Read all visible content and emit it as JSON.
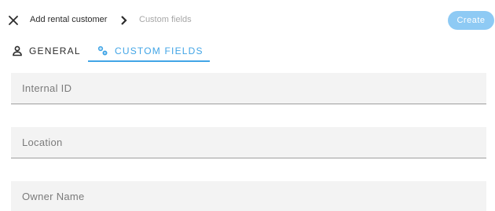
{
  "header": {
    "title": "Add rental customer",
    "current": "Custom fields",
    "create_label": "Create",
    "close_icon": "close-icon",
    "separator_icon": "chevron-right-icon"
  },
  "tabs": [
    {
      "label": "GENERAL",
      "icon": "person-icon",
      "active": false
    },
    {
      "label": "CUSTOM FIELDS",
      "icon": "gears-icon",
      "active": true
    }
  ],
  "fields": [
    {
      "label": "Internal ID",
      "value": ""
    },
    {
      "label": "Location",
      "value": ""
    },
    {
      "label": "Owner Name",
      "value": ""
    }
  ],
  "colors": {
    "accent": "#42a5e6",
    "create_button": "#8ecaf4",
    "field_background": "#f3f3f3",
    "field_label": "#7b7b7b"
  }
}
